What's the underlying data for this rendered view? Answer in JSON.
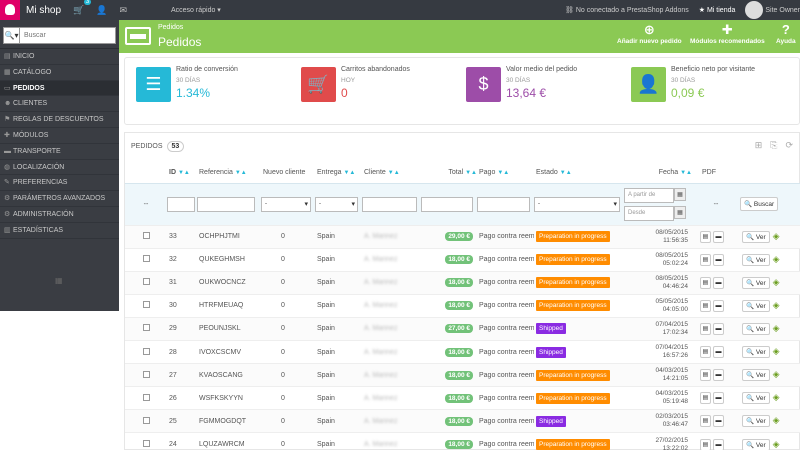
{
  "topbar": {
    "shop_name": "Mi shop",
    "cart_badge": "3",
    "quick_access": "Acceso rápido",
    "addons_status": "No conectado a PrestaShop Addons",
    "my_store": "Mi tienda",
    "user": "Site Owner"
  },
  "search": {
    "placeholder": "Buscar"
  },
  "sidebar": {
    "items": [
      {
        "label": "INICIO"
      },
      {
        "label": "CATÁLOGO"
      },
      {
        "label": "PEDIDOS"
      },
      {
        "label": "CLIENTES"
      },
      {
        "label": "REGLAS DE DESCUENTOS"
      },
      {
        "label": "MÓDULOS"
      },
      {
        "label": "TRANSPORTE"
      },
      {
        "label": "LOCALIZACIÓN"
      },
      {
        "label": "PREFERENCIAS"
      },
      {
        "label": "PARÁMETROS AVANZADOS"
      },
      {
        "label": "ADMINISTRACIÓN"
      },
      {
        "label": "ESTADÍSTICAS"
      }
    ]
  },
  "header": {
    "breadcrumb": "Pedidos",
    "title": "Pedidos",
    "btn_add": "Añadir nuevo pedido",
    "btn_modules": "Módulos recomendados",
    "btn_help": "Ayuda"
  },
  "kpis": [
    {
      "title": "Ratio de conversión",
      "period": "30 DÍAS",
      "value": "1.34%",
      "color": "#25b9d7",
      "icon": "list-icon"
    },
    {
      "title": "Carritos abandonados",
      "period": "HOY",
      "value": "0",
      "color": "#e04b4b",
      "icon": "cart-icon"
    },
    {
      "title": "Valor medio del pedido",
      "period": "30 DÍAS",
      "value": "13,64 €",
      "color": "#9d4da8",
      "icon": "money-icon"
    },
    {
      "title": "Beneficio neto por visitante",
      "period": "30 DÍAS",
      "value": "0,09 €",
      "color": "#8bc954",
      "icon": "user-icon"
    }
  ],
  "panel": {
    "title": "PEDIDOS",
    "count": "53"
  },
  "table": {
    "headers": {
      "id": "ID",
      "ref": "Referencia",
      "new": "Nuevo cliente",
      "delivery": "Entrega",
      "customer": "Cliente",
      "total": "Total",
      "payment": "Pago",
      "status": "Estado",
      "date": "Fecha",
      "pdf": "PDF"
    },
    "filters": {
      "from_placeholder": "A partir de",
      "to_placeholder": "Desde",
      "select_default": "-",
      "search_button": "Buscar",
      "empty_mark": "--"
    },
    "view_label": "Ver",
    "rows": [
      {
        "id": "33",
        "ref": "OCHPHJTMI",
        "new": "0",
        "delivery": "Spain",
        "customer": "A. Marinez",
        "total": "29,00 €",
        "payment": "Pago contra reembolso",
        "status": "Preparation in progress",
        "status_color": "#ff8c00",
        "date": "08/05/2015",
        "time": "11:56:35"
      },
      {
        "id": "32",
        "ref": "QUKEGHMSH",
        "new": "0",
        "delivery": "Spain",
        "customer": "A. Marinez",
        "total": "18,00 €",
        "payment": "Pago contra reembolso",
        "status": "Preparation in progress",
        "status_color": "#ff8c00",
        "date": "08/05/2015",
        "time": "05:02:24"
      },
      {
        "id": "31",
        "ref": "OUKWOCNCZ",
        "new": "0",
        "delivery": "Spain",
        "customer": "A. Marinez",
        "total": "18,00 €",
        "payment": "Pago contra reembolso",
        "status": "Preparation in progress",
        "status_color": "#ff8c00",
        "date": "08/05/2015",
        "time": "04:46:24"
      },
      {
        "id": "30",
        "ref": "HTRFMEUAQ",
        "new": "0",
        "delivery": "Spain",
        "customer": "A. Marinez",
        "total": "18,00 €",
        "payment": "Pago contra reembolso",
        "status": "Preparation in progress",
        "status_color": "#ff8c00",
        "date": "05/05/2015",
        "time": "04:05:00"
      },
      {
        "id": "29",
        "ref": "PEOUNJSKL",
        "new": "0",
        "delivery": "Spain",
        "customer": "A. Marinez",
        "total": "27,00 €",
        "payment": "Pago contra reembolso",
        "status": "Shipped",
        "status_color": "#8a2be2",
        "date": "07/04/2015",
        "time": "17:02:34"
      },
      {
        "id": "28",
        "ref": "IVOXCSCMV",
        "new": "0",
        "delivery": "Spain",
        "customer": "A. Marinez",
        "total": "18,00 €",
        "payment": "Pago contra reembolso",
        "status": "Shipped",
        "status_color": "#8a2be2",
        "date": "07/04/2015",
        "time": "16:57:26"
      },
      {
        "id": "27",
        "ref": "KVAOSCANG",
        "new": "0",
        "delivery": "Spain",
        "customer": "A. Marinez",
        "total": "18,00 €",
        "payment": "Pago contra reembolso",
        "status": "Preparation in progress",
        "status_color": "#ff8c00",
        "date": "04/03/2015",
        "time": "14:21:05"
      },
      {
        "id": "26",
        "ref": "WSFKSKYYN",
        "new": "0",
        "delivery": "Spain",
        "customer": "A. Marinez",
        "total": "18,00 €",
        "payment": "Pago contra reembolso",
        "status": "Preparation in progress",
        "status_color": "#ff8c00",
        "date": "04/03/2015",
        "time": "05:19:48"
      },
      {
        "id": "25",
        "ref": "FGMMOGDQT",
        "new": "0",
        "delivery": "Spain",
        "customer": "A. Marinez",
        "total": "18,00 €",
        "payment": "Pago contra reembolso",
        "status": "Shipped",
        "status_color": "#8a2be2",
        "date": "02/03/2015",
        "time": "03:46:47"
      },
      {
        "id": "24",
        "ref": "LQUZAWRCM",
        "new": "0",
        "delivery": "Spain",
        "customer": "A. Marinez",
        "total": "18,00 €",
        "payment": "Pago contra reembolso",
        "status": "Preparation in progress",
        "status_color": "#ff8c00",
        "date": "27/02/2015",
        "time": "13:22:02"
      }
    ]
  }
}
